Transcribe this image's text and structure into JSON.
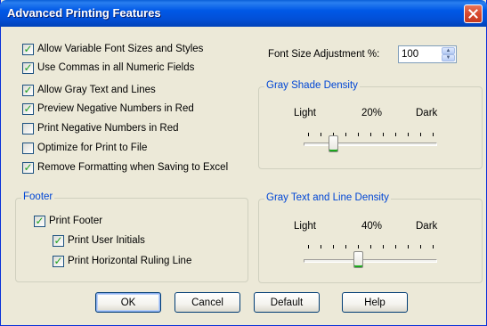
{
  "window": {
    "title": "Advanced Printing Features"
  },
  "options": [
    {
      "label": "Allow Variable Font Sizes and Styles",
      "checked": true
    },
    {
      "label": "Use Commas in all Numeric Fields",
      "checked": true
    },
    {
      "label": "Allow Gray Text and Lines",
      "checked": true
    },
    {
      "label": "Preview Negative Numbers in Red",
      "checked": true
    },
    {
      "label": "Print Negative Numbers in Red",
      "checked": false
    },
    {
      "label": "Optimize for Print to File",
      "checked": false
    },
    {
      "label": "Remove Formatting when Saving to Excel",
      "checked": true
    }
  ],
  "font_size": {
    "label": "Font Size Adjustment %:",
    "value": "100"
  },
  "gray_shade": {
    "title": "Gray Shade Density",
    "min_label": "Light",
    "max_label": "Dark",
    "value_label": "20%",
    "value": 0.2
  },
  "gray_text": {
    "title": "Gray Text and Line Density",
    "min_label": "Light",
    "max_label": "Dark",
    "value_label": "40%",
    "value": 0.4
  },
  "footer": {
    "title": "Footer",
    "print_footer": {
      "label": "Print Footer",
      "checked": true
    },
    "print_user_initials": {
      "label": "Print User Initials",
      "checked": true
    },
    "print_ruling_line": {
      "label": "Print Horizontal Ruling Line",
      "checked": true
    }
  },
  "buttons": {
    "ok": "OK",
    "cancel": "Cancel",
    "default": "Default",
    "help": "Help"
  },
  "colors": {
    "title_bar": "#0058e6",
    "group_title": "#0046d5",
    "check_mark": "#21a121",
    "face": "#ece9d8"
  }
}
